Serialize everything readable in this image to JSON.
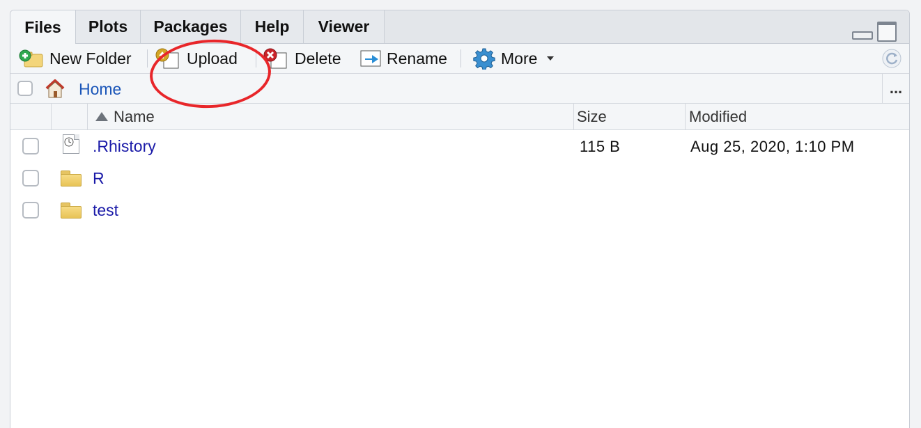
{
  "tabs": [
    {
      "label": "Files",
      "active": true
    },
    {
      "label": "Plots",
      "active": false
    },
    {
      "label": "Packages",
      "active": false
    },
    {
      "label": "Help",
      "active": false
    },
    {
      "label": "Viewer",
      "active": false
    }
  ],
  "toolbar": {
    "new_folder_label": "New Folder",
    "upload_label": "Upload",
    "delete_label": "Delete",
    "rename_label": "Rename",
    "more_label": "More"
  },
  "path": {
    "home_label": "Home",
    "more_label": "..."
  },
  "table": {
    "columns": {
      "name": "Name",
      "size": "Size",
      "modified": "Modified"
    },
    "sort": {
      "column": "Name",
      "direction": "ascending"
    },
    "rows": [
      {
        "name": ".Rhistory",
        "type": "file",
        "size": "115 B",
        "modified": "Aug 25, 2020, 1:10 PM"
      },
      {
        "name": "R",
        "type": "folder",
        "size": "",
        "modified": ""
      },
      {
        "name": "test",
        "type": "folder",
        "size": "",
        "modified": ""
      }
    ]
  },
  "colors": {
    "link": "#1a1aa8",
    "home_link": "#1a55b8",
    "annotation": "#e8262a",
    "toolbar_bg": "#f4f6f8"
  },
  "icons": [
    "new-folder-icon",
    "upload-icon",
    "delete-icon",
    "rename-icon",
    "gear-icon",
    "refresh-icon",
    "home-icon",
    "history-file-icon",
    "folder-icon"
  ]
}
